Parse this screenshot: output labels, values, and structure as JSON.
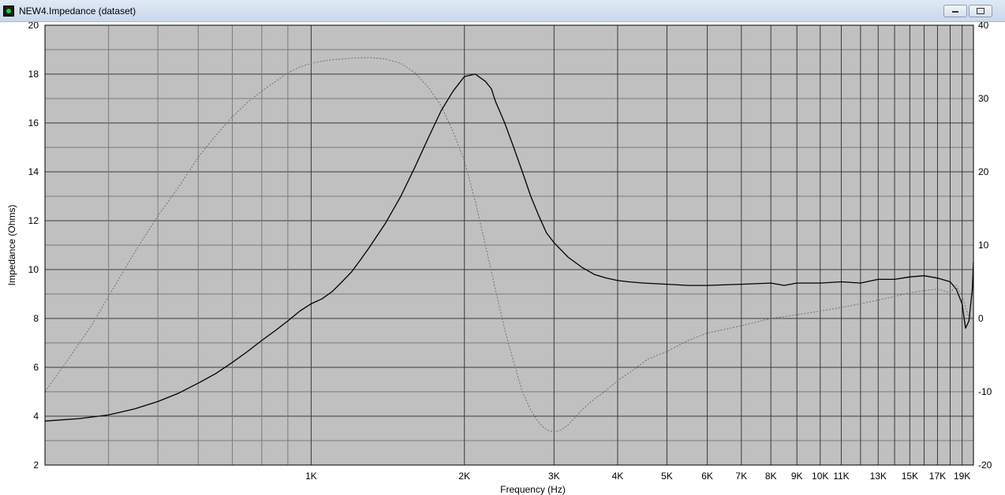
{
  "window": {
    "title": "NEW4.Impedance (dataset)"
  },
  "chart_data": {
    "type": "line",
    "xlabel": "Frequency (Hz)",
    "ylabel": "Impedance (Ohms)",
    "x_scale": "log",
    "xlim": [
      300,
      20000
    ],
    "ylim": [
      2,
      20
    ],
    "y2lim": [
      -20,
      40
    ],
    "grid": true,
    "plot_background": "#c0c0c0",
    "x_ticks": [
      {
        "value": 1000,
        "label": "1K"
      },
      {
        "value": 2000,
        "label": "2K"
      },
      {
        "value": 3000,
        "label": "3K"
      },
      {
        "value": 4000,
        "label": "4K"
      },
      {
        "value": 5000,
        "label": "5K"
      },
      {
        "value": 6000,
        "label": "6K"
      },
      {
        "value": 7000,
        "label": "7K"
      },
      {
        "value": 8000,
        "label": "8K"
      },
      {
        "value": 9000,
        "label": "9K"
      },
      {
        "value": 10000,
        "label": "10K"
      },
      {
        "value": 11000,
        "label": "11K"
      },
      {
        "value": 13000,
        "label": "13K"
      },
      {
        "value": 15000,
        "label": "15K"
      },
      {
        "value": 17000,
        "label": "17K"
      },
      {
        "value": 19000,
        "label": "19K"
      }
    ],
    "x_minor_grid": [
      12000,
      14000,
      16000,
      18000,
      20000
    ],
    "y_ticks": [
      2,
      4,
      6,
      8,
      10,
      12,
      14,
      16,
      18,
      20
    ],
    "y2_ticks": [
      -20,
      -10,
      0,
      10,
      20,
      30,
      40
    ],
    "series": [
      {
        "axis": "left",
        "color": "#000000",
        "style": "solid",
        "x": [
          300,
          350,
          400,
          450,
          500,
          550,
          600,
          650,
          700,
          750,
          800,
          850,
          900,
          950,
          1000,
          1050,
          1100,
          1150,
          1200,
          1250,
          1300,
          1400,
          1500,
          1600,
          1700,
          1800,
          1900,
          2000,
          2100,
          2200,
          2260,
          2300,
          2400,
          2500,
          2600,
          2700,
          2800,
          2900,
          3000,
          3200,
          3400,
          3600,
          3800,
          4000,
          4200,
          4500,
          5000,
          5500,
          6000,
          7000,
          8000,
          8500,
          9000,
          10000,
          11000,
          12000,
          13000,
          14000,
          15000,
          16000,
          17000,
          18000,
          18500,
          19000,
          19300,
          19600,
          19900,
          20000
        ],
        "values": [
          3.8,
          3.9,
          4.05,
          4.3,
          4.6,
          4.95,
          5.35,
          5.75,
          6.2,
          6.65,
          7.1,
          7.5,
          7.9,
          8.3,
          8.6,
          8.8,
          9.1,
          9.5,
          9.9,
          10.4,
          10.9,
          11.9,
          13.0,
          14.2,
          15.4,
          16.5,
          17.3,
          17.9,
          18.0,
          17.7,
          17.4,
          16.9,
          16.0,
          15.0,
          14.0,
          13.0,
          12.2,
          11.5,
          11.1,
          10.5,
          10.1,
          9.8,
          9.65,
          9.55,
          9.5,
          9.45,
          9.4,
          9.35,
          9.35,
          9.4,
          9.45,
          9.35,
          9.45,
          9.45,
          9.5,
          9.45,
          9.6,
          9.6,
          9.7,
          9.75,
          9.65,
          9.5,
          9.2,
          8.6,
          7.6,
          7.9,
          9.2,
          10.3
        ]
      },
      {
        "axis": "right",
        "color": "#6e6e6e",
        "style": "dotted",
        "x": [
          300,
          330,
          370,
          400,
          450,
          500,
          550,
          600,
          650,
          700,
          750,
          800,
          850,
          900,
          950,
          1000,
          1050,
          1100,
          1200,
          1300,
          1400,
          1500,
          1600,
          1700,
          1800,
          1900,
          2000,
          2100,
          2200,
          2300,
          2400,
          2500,
          2600,
          2700,
          2800,
          2900,
          3000,
          3100,
          3200,
          3300,
          3400,
          3600,
          3800,
          4000,
          4300,
          4600,
          5000,
          5500,
          6000,
          7000,
          8000,
          9000,
          10000,
          11000,
          12000,
          13000,
          14000,
          15000,
          16000,
          17000,
          18000,
          18500,
          19000,
          19500,
          20000
        ],
        "values": [
          -10,
          -6,
          -1,
          3,
          9,
          14,
          18,
          22,
          25,
          27.5,
          29.5,
          31,
          32.3,
          33.5,
          34.3,
          34.8,
          35.1,
          35.3,
          35.5,
          35.6,
          35.4,
          34.8,
          33.5,
          31.5,
          29,
          25.5,
          21.5,
          16,
          10,
          4,
          -1.5,
          -6,
          -10,
          -12.5,
          -14.2,
          -15.2,
          -15.5,
          -15.2,
          -14.5,
          -13.5,
          -12.5,
          -11,
          -9.8,
          -8.5,
          -7,
          -5.5,
          -4.5,
          -3,
          -2,
          -1,
          0,
          0.5,
          1,
          1.5,
          2,
          2.5,
          3,
          3.5,
          3.8,
          4,
          3.5,
          4.5,
          3,
          0.5,
          0
        ]
      }
    ]
  }
}
